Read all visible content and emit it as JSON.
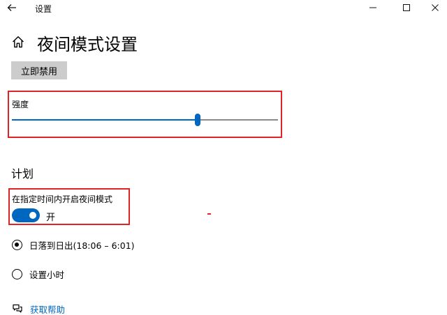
{
  "window": {
    "title": "设置"
  },
  "header": {
    "title": "夜间模式设置"
  },
  "actions": {
    "disable_now_label": "立即禁用"
  },
  "strength": {
    "label": "强度",
    "value_fraction": 0.698
  },
  "schedule": {
    "heading": "计划",
    "toggle_label": "在指定时间内开启夜间模式",
    "toggle_on": true,
    "toggle_state_text": "开",
    "options": [
      {
        "label": "日落到日出(18:06 – 6:01)",
        "selected": true
      },
      {
        "label": "设置小时",
        "selected": false
      }
    ]
  },
  "help": {
    "link_label": "获取帮助"
  },
  "colors": {
    "accent": "#0067c0",
    "annotation": "#e02424",
    "button_bg": "#cccccc"
  }
}
